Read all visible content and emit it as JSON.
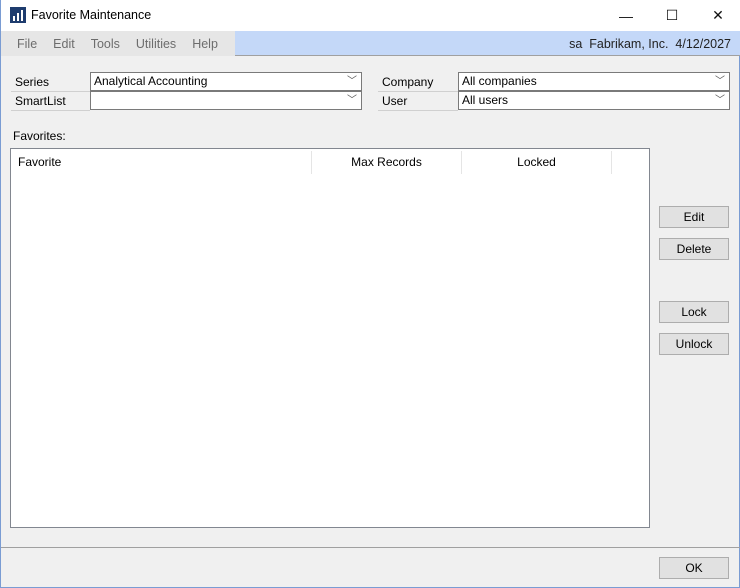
{
  "window": {
    "title": "Favorite Maintenance",
    "minimize": "—",
    "maximize": "☐",
    "close": "✕"
  },
  "menu": [
    "File",
    "Edit",
    "Tools",
    "Utilities",
    "Help"
  ],
  "status": {
    "user": "sa",
    "company": "Fabrikam, Inc.",
    "date": "4/12/2027"
  },
  "fields": {
    "series": {
      "label": "Series",
      "value": "Analytical Accounting"
    },
    "smartlist": {
      "label": "SmartList",
      "value": ""
    },
    "company": {
      "label": "Company",
      "value": "All companies"
    },
    "user": {
      "label": "User",
      "value": "All users"
    }
  },
  "favorites": {
    "label": "Favorites:",
    "columns": [
      "Favorite",
      "Max Records",
      "Locked"
    ],
    "rows": []
  },
  "buttons": {
    "edit": "Edit",
    "delete": "Delete",
    "lock": "Lock",
    "unlock": "Unlock",
    "ok": "OK"
  }
}
